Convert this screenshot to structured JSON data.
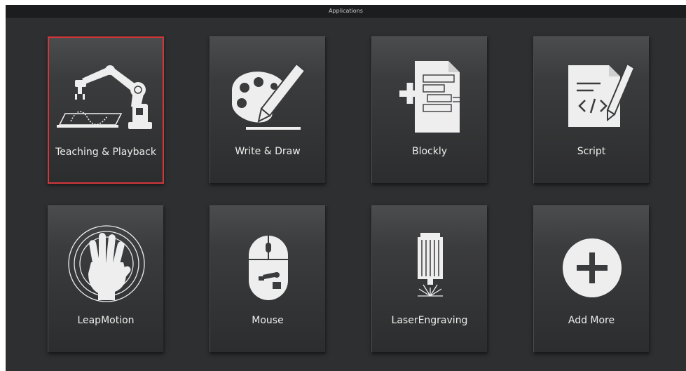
{
  "window": {
    "title": "Applications"
  },
  "tiles": [
    {
      "label": "Teaching & Playback",
      "icon": "robot-arm-icon",
      "selected": true
    },
    {
      "label": "Write & Draw",
      "icon": "palette-pencil-icon"
    },
    {
      "label": "Blockly",
      "icon": "blockly-document-icon"
    },
    {
      "label": "Script",
      "icon": "script-document-icon"
    },
    {
      "label": "LeapMotion",
      "icon": "hand-icon"
    },
    {
      "label": "Mouse",
      "icon": "mouse-icon"
    },
    {
      "label": "LaserEngraving",
      "icon": "laser-icon"
    },
    {
      "label": "Add More",
      "icon": "add-circle-icon"
    }
  ],
  "colors": {
    "background": "#2d2f30",
    "tile_selected_border": "#d2373a",
    "icon": "#eeeeee"
  }
}
